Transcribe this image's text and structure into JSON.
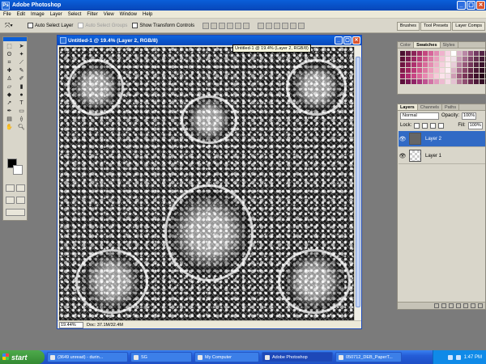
{
  "app": {
    "title": "Adobe Photoshop"
  },
  "menu": [
    "File",
    "Edit",
    "Image",
    "Layer",
    "Select",
    "Filter",
    "View",
    "Window",
    "Help"
  ],
  "options": {
    "auto_select_layer": "Auto Select Layer",
    "auto_select_groups": "Auto Select Groups",
    "show_transform_controls": "Show Transform Controls"
  },
  "palette_well": [
    "Brushes",
    "Tool Presets",
    "Layer Comps"
  ],
  "document": {
    "title": "Untitled-1 @ 19.4% (Layer 2, RGB/8)",
    "tooltip": "Untitled-1 @ 19.4% (Layer 2, RGB/8)",
    "zoom": "19.44%",
    "doc_info": "Doc: 37.1M/32.4M"
  },
  "swatches": {
    "tabs": [
      "Color",
      "Swatches",
      "Styles"
    ],
    "active_tab": "Swatches",
    "colors": [
      "#4a1030",
      "#6a1a45",
      "#8a2458",
      "#a82e6b",
      "#c4477f",
      "#d6659a",
      "#e38ab3",
      "#efb2cd",
      "#f7d4e4",
      "#ffffff",
      "#d9b3c8",
      "#b988a6",
      "#96587f",
      "#733a62",
      "#552547",
      "#3a152f",
      "#5c1238",
      "#7c1d4f",
      "#9b2963",
      "#b83c78",
      "#cf5a8e",
      "#de7ba6",
      "#ea9fbe",
      "#f3c3d6",
      "#fbe3ec",
      "#f0e0e8",
      "#c79bb4",
      "#a56f8f",
      "#83476c",
      "#63304f",
      "#451d37",
      "#2c0f22",
      "#6e1441",
      "#8e2058",
      "#ad306d",
      "#c64a83",
      "#d86b9a",
      "#e48eb1",
      "#eeb1c8",
      "#f6d0de",
      "#fde9f0",
      "#e8ccd9",
      "#b882a1",
      "#955879",
      "#733559",
      "#552240",
      "#3a132b",
      "#220a19",
      "#801748",
      "#a0235f",
      "#bc3877",
      "#d2558c",
      "#e077a3",
      "#eb9aba",
      "#f3bccf",
      "#f9d9e4",
      "#fff0f5",
      "#dcb4c7",
      "#aa6f8f",
      "#874567",
      "#66294a",
      "#491834",
      "#300c21",
      "#1a0512",
      "#93185a",
      "#b12b6f",
      "#c84684",
      "#db669a",
      "#e888b1",
      "#f1abc6",
      "#f7cbda",
      "#fce3eb",
      "#f4dde7",
      "#cf9db5",
      "#9c5b7c",
      "#7a3558",
      "#5a1f3f",
      "#3f122b",
      "#28091a",
      "#14040c",
      "#5b0e3a",
      "#751751",
      "#902366",
      "#a9357b",
      "#bf5291",
      "#d274a6",
      "#e198bc",
      "#edbbd1",
      "#f6dbe6",
      "#e3c1d1",
      "#b47b98",
      "#8f4e71",
      "#6c2d51",
      "#4e1a39",
      "#340e25",
      "#1e0714"
    ],
    "swatch_count": 96
  },
  "layers": {
    "tabs": [
      "Layers",
      "Channels",
      "Paths"
    ],
    "active_tab": "Layers",
    "blend_mode": "Normal",
    "opacity_label": "Opacity:",
    "opacity": "100%",
    "lock_label": "Lock:",
    "fill_label": "Fill:",
    "fill": "100%",
    "items": [
      {
        "name": "Layer 2",
        "selected": true
      },
      {
        "name": "Layer 1",
        "selected": false
      }
    ]
  },
  "taskbar": {
    "start": "start",
    "items": [
      "(3649 unread) - durin...",
      "SG",
      "My Computer",
      "Adobe Photoshop",
      "050712_DEB_PaperT..."
    ],
    "active_index": 3,
    "clock": "1:47 PM"
  }
}
